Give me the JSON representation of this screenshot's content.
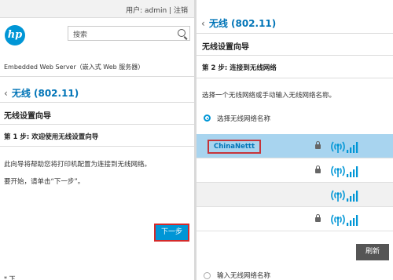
{
  "left": {
    "user_bar": "用户: admin | 注销",
    "logo_text": "hp",
    "search_placeholder": "搜索",
    "ews_label": "Embedded Web Server（嵌入式 Web 服务器）",
    "section_title": "无线 (802.11)",
    "wizard_title": "无线设置向导",
    "step_title": "第 1 步: 欢迎使用无线设置向导",
    "intro_text": "此向导将帮助您将打印机配置为连接到无线网络。",
    "start_text": "要开始，请单击“下一步”。",
    "next_button": "下一步",
    "cut_text": "* 下"
  },
  "right": {
    "section_title": "无线 (802.11)",
    "wizard_title": "无线设置向导",
    "step_title": "第 2 步: 连接到无线网络",
    "instruction": "选择一个无线网络或手动输入无线网络名称。",
    "option_select": "选择无线网络名称",
    "networks": [
      {
        "name": "ChinaNettt",
        "locked": true,
        "selected": true
      },
      {
        "name": "",
        "locked": true,
        "selected": false
      },
      {
        "name": "",
        "locked": false,
        "selected": false
      },
      {
        "name": "",
        "locked": true,
        "selected": false
      }
    ],
    "refresh_button": "刷新",
    "option_manual": "输入无线网络名称"
  },
  "colors": {
    "accent": "#0096d6",
    "title_blue": "#0074b7",
    "highlight_red": "#d42a2a",
    "selected_row": "#a8d4ef"
  },
  "icons": [
    "hp-logo",
    "search-icon",
    "chevron-left-icon",
    "lock-icon",
    "wifi-signal-icon",
    "radio-button"
  ]
}
